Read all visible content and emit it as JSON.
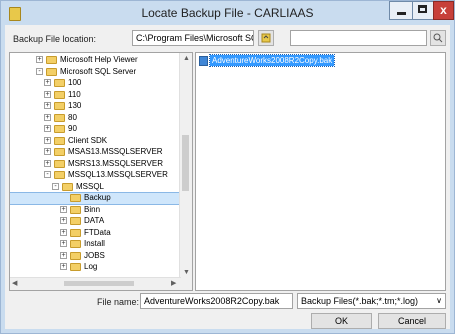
{
  "window": {
    "title": "Locate Backup File - CARLIAAS",
    "close_glyph": "x"
  },
  "location": {
    "label": "Backup File location:",
    "value": "C:\\Program Files\\Microsoft SQL Server\\MSSQ",
    "search_value": ""
  },
  "tree": [
    {
      "label": "Microsoft Help Viewer",
      "expander": "+"
    },
    {
      "label": "Microsoft SQL Server",
      "expander": "-"
    },
    {
      "label": "100",
      "expander": "+"
    },
    {
      "label": "110",
      "expander": "+"
    },
    {
      "label": "130",
      "expander": "+"
    },
    {
      "label": "80",
      "expander": "+"
    },
    {
      "label": "90",
      "expander": "+"
    },
    {
      "label": "Client SDK",
      "expander": "+"
    },
    {
      "label": "MSAS13.MSSQLSERVER",
      "expander": "+"
    },
    {
      "label": "MSRS13.MSSQLSERVER",
      "expander": "+"
    },
    {
      "label": "MSSQL13.MSSQLSERVER",
      "expander": "-"
    },
    {
      "label": "MSSQL",
      "expander": "-"
    },
    {
      "label": "Backup",
      "expander": ""
    },
    {
      "label": "Binn",
      "expander": "+"
    },
    {
      "label": "DATA",
      "expander": "+"
    },
    {
      "label": "FTData",
      "expander": "+"
    },
    {
      "label": "Install",
      "expander": "+"
    },
    {
      "label": "JOBS",
      "expander": "+"
    },
    {
      "label": "Log",
      "expander": "+"
    }
  ],
  "files": [
    {
      "name": "AdventureWorks2008R2Copy.bak"
    }
  ],
  "bottom": {
    "filename_label": "File name:",
    "filename_value": "AdventureWorks2008R2Copy.bak",
    "filter_value": "Backup Files(*.bak;*.tm;*.log)",
    "ok_label": "OK",
    "cancel_label": "Cancel"
  },
  "colors": {
    "accent": "#3399ff",
    "titlebar": "#c9dcef",
    "close": "#c7403a"
  }
}
